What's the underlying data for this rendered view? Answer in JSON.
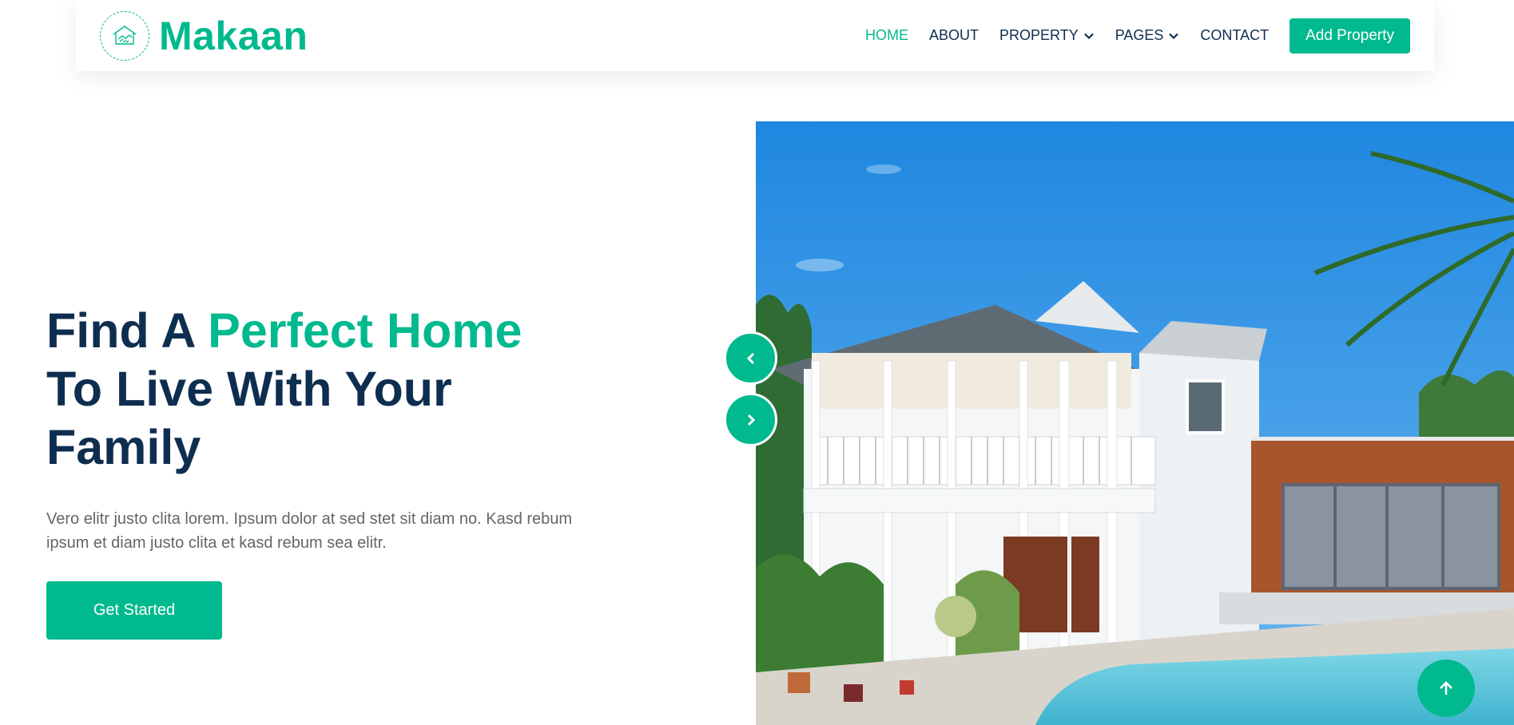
{
  "brand": {
    "name": "Makaan",
    "logo_icon": "handshake-house-icon",
    "accent_color": "#00B98E",
    "dark_color": "#0E2E50"
  },
  "nav": {
    "items": [
      {
        "label": "HOME",
        "active": true
      },
      {
        "label": "ABOUT"
      },
      {
        "label": "PROPERTY",
        "dropdown": true
      },
      {
        "label": "PAGES",
        "dropdown": true
      },
      {
        "label": "CONTACT"
      }
    ],
    "cta_label": "Add Property"
  },
  "hero": {
    "title_part1": "Find A ",
    "title_accent": "Perfect Home",
    "title_part2": "To Live With Your",
    "title_part3": "Family",
    "description": "Vero elitr justo clita lorem. Ipsum dolor at sed stet sit diam no. Kasd rebum ipsum et diam justo clita et kasd rebum sea elitr.",
    "cta_label": "Get Started"
  },
  "carousel": {
    "prev_icon": "chevron-left-icon",
    "next_icon": "chevron-right-icon"
  },
  "back_to_top_icon": "arrow-up-icon"
}
